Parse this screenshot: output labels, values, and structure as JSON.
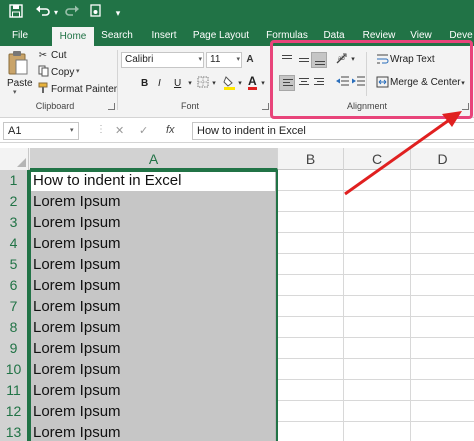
{
  "quick_access": {
    "save_icon": "save-icon",
    "undo_icon": "undo-icon",
    "redo_icon": "redo-icon",
    "touch_icon": "touch-mode-icon",
    "customize_icon": "customize-qat-icon"
  },
  "tabs": [
    "File",
    "Home",
    "Search",
    "Insert",
    "Page Layout",
    "Formulas",
    "Data",
    "Review",
    "View",
    "Deve"
  ],
  "active_tab": "Home",
  "ribbon": {
    "clipboard": {
      "paste_label": "Paste",
      "cut_label": "Cut",
      "copy_label": "Copy",
      "format_painter_label": "Format Painter",
      "group_label": "Clipboard"
    },
    "font": {
      "font_name": "Calibri",
      "font_size": "11",
      "bold_label": "B",
      "italic_label": "I",
      "underline_label": "U",
      "font_color_label": "A",
      "group_label": "Font"
    },
    "alignment": {
      "wrap_text_label": "Wrap Text",
      "merge_center_label": "Merge & Center",
      "group_label": "Alignment"
    }
  },
  "formula_bar": {
    "name_box": "A1",
    "cancel_symbol": "✕",
    "enter_symbol": "✓",
    "fx_label": "fx",
    "formula": "How to indent in Excel"
  },
  "columns": [
    "A",
    "B",
    "C",
    "D"
  ],
  "rows": [
    {
      "num": "1",
      "a": "How to indent in Excel"
    },
    {
      "num": "2",
      "a": "Lorem Ipsum"
    },
    {
      "num": "3",
      "a": "Lorem Ipsum"
    },
    {
      "num": "4",
      "a": "Lorem Ipsum"
    },
    {
      "num": "5",
      "a": "Lorem Ipsum"
    },
    {
      "num": "6",
      "a": "Lorem Ipsum"
    },
    {
      "num": "7",
      "a": "Lorem Ipsum"
    },
    {
      "num": "8",
      "a": "Lorem Ipsum"
    },
    {
      "num": "9",
      "a": "Lorem Ipsum"
    },
    {
      "num": "10",
      "a": "Lorem Ipsum"
    },
    {
      "num": "11",
      "a": "Lorem Ipsum"
    },
    {
      "num": "12",
      "a": "Lorem Ipsum"
    },
    {
      "num": "13",
      "a": "Lorem Ipsum"
    }
  ],
  "colors": {
    "excel_green": "#217346",
    "highlight_pink": "#e8447a",
    "arrow_red": "#e02020",
    "selection_gray": "#c6c6c6"
  }
}
